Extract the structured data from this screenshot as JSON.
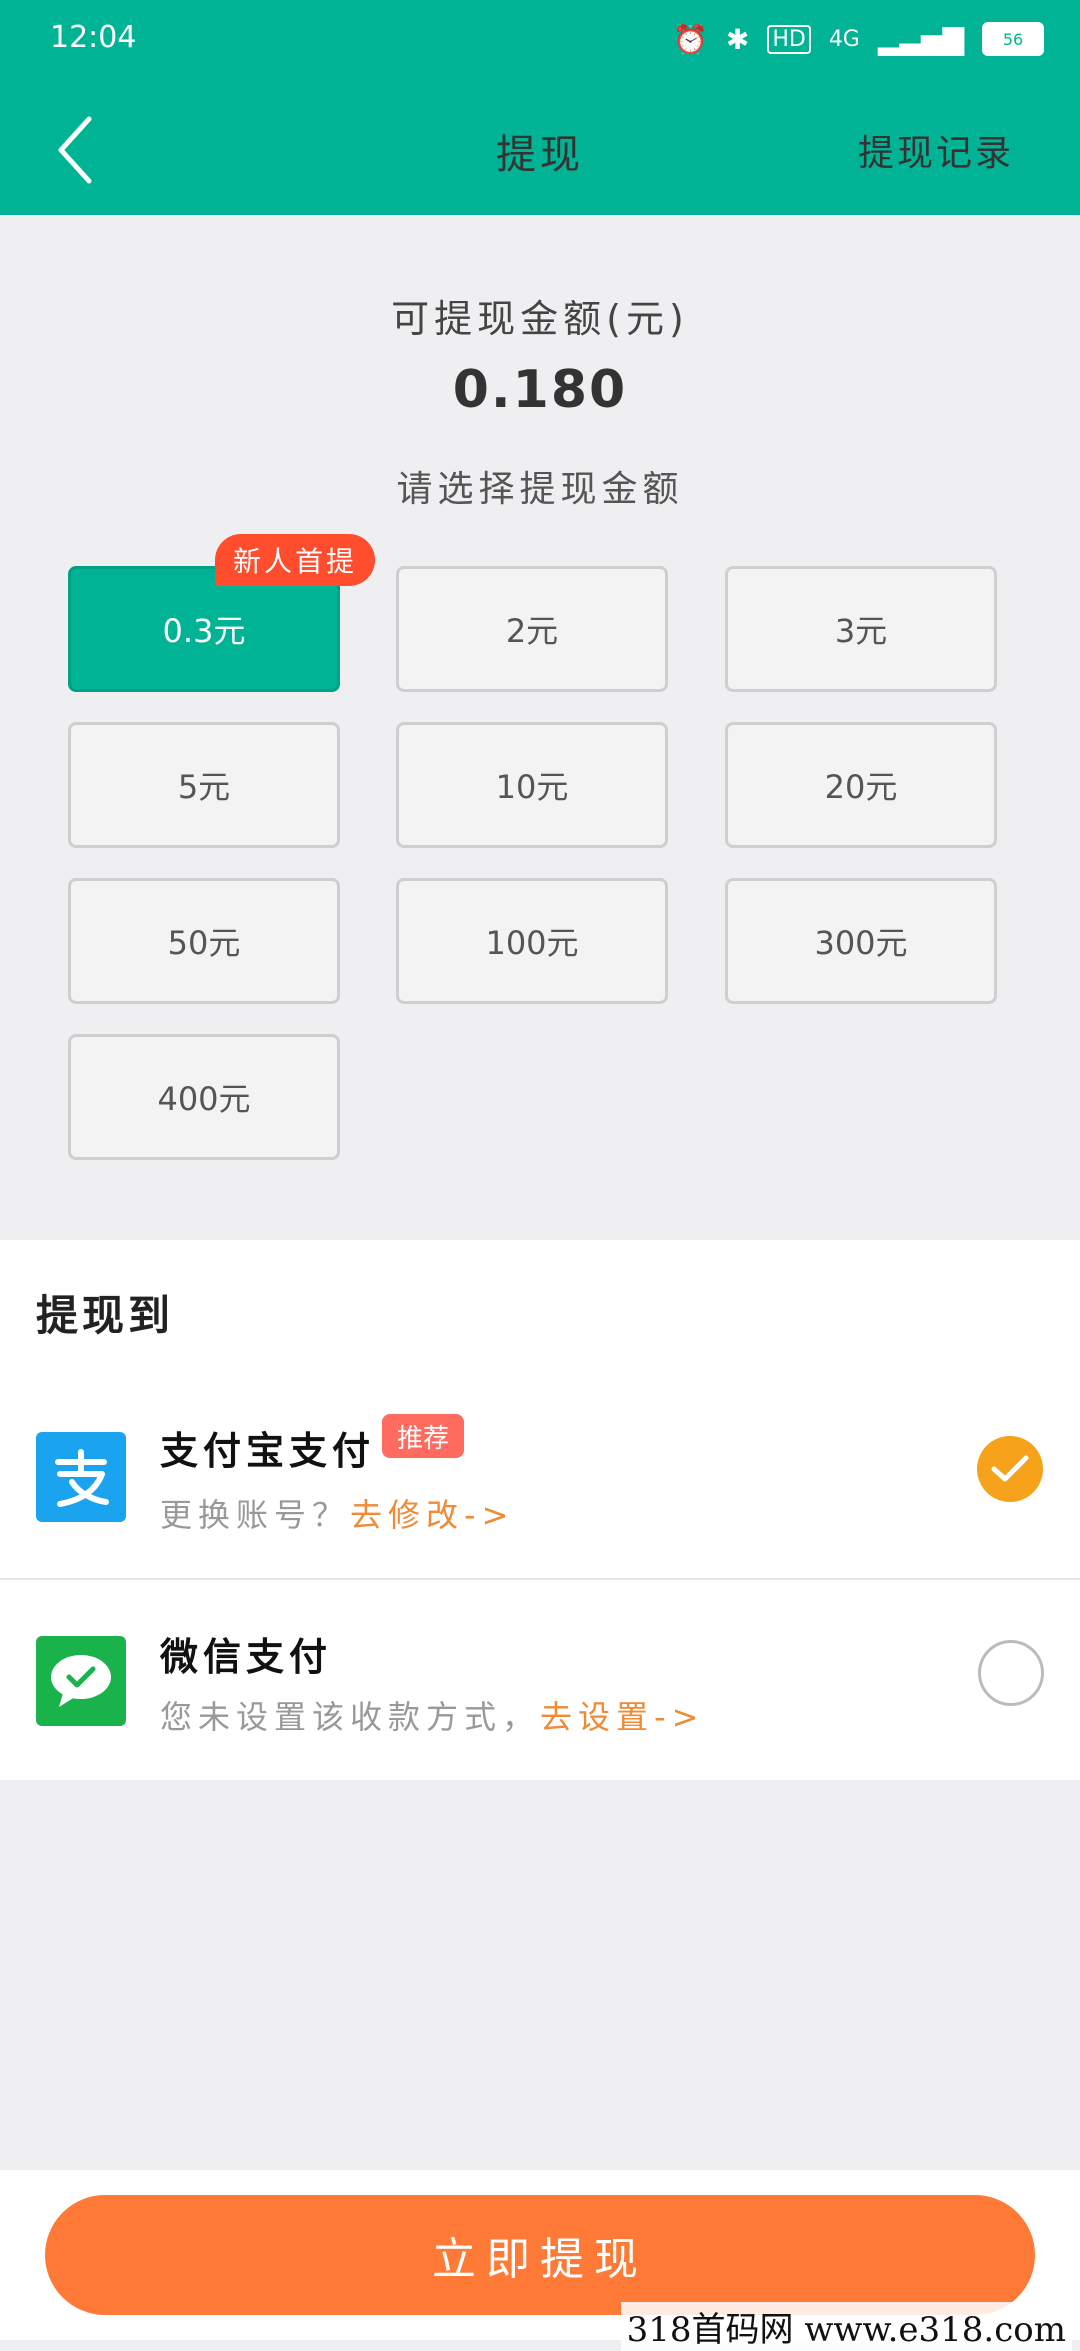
{
  "status_bar": {
    "time": "12:04",
    "network": "4G",
    "hd": "HD",
    "battery": "56"
  },
  "header": {
    "title": "提现",
    "record_link": "提现记录"
  },
  "balance": {
    "label": "可提现金额(元)",
    "value": "0.180"
  },
  "amount_section": {
    "label": "请选择提现金额",
    "new_user_badge": "新人首提",
    "options": [
      "0.3元",
      "2元",
      "3元",
      "5元",
      "10元",
      "20元",
      "50元",
      "100元",
      "300元",
      "400元"
    ],
    "selected": "0.3元"
  },
  "pay_section": {
    "title": "提现到",
    "alipay": {
      "name": "支付宝支付",
      "badge": "推荐",
      "sub": "更换账号？",
      "link": "去修改->",
      "selected": true
    },
    "wechat": {
      "name": "微信支付",
      "sub": "您未设置该收款方式，",
      "link": "去设置->",
      "selected": false
    }
  },
  "submit_label": "立即提现",
  "watermark": "318首码网   www.e318.com",
  "colors": {
    "brand": "#00b394",
    "accent": "#ff7a36",
    "link": "#f08a33",
    "check": "#f7a21b"
  }
}
